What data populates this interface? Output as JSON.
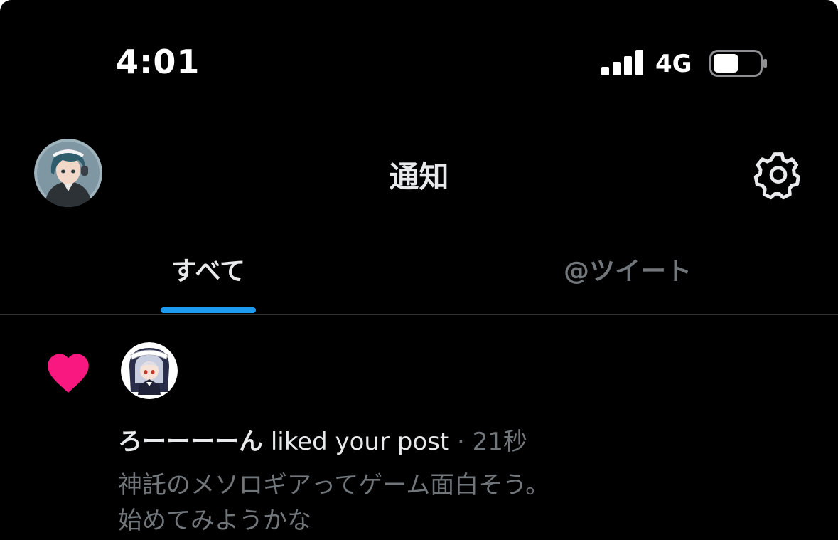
{
  "status_bar": {
    "time": "4:01",
    "network": "4G",
    "battery_level": 0.55
  },
  "header": {
    "title": "通知"
  },
  "tabs": [
    {
      "label": "すべて",
      "active": true
    },
    {
      "label": "@ツイート",
      "active": false
    }
  ],
  "notification": {
    "type": "like",
    "user_name": "ろーーーーん",
    "action_text": "liked your post",
    "separator": "·",
    "time": "21秒",
    "post_line1": "神託のメソロギアってゲーム面白そう。",
    "post_line2": "始めてみようかな"
  },
  "colors": {
    "background": "#000000",
    "accent": "#1d9bf0",
    "like": "#f91880",
    "text_primary": "#e7e9ea",
    "text_secondary": "#71767b"
  },
  "icons": {
    "settings": "gear-icon",
    "like": "heart-icon",
    "signal": "cellular-signal-icon",
    "battery": "battery-icon"
  }
}
